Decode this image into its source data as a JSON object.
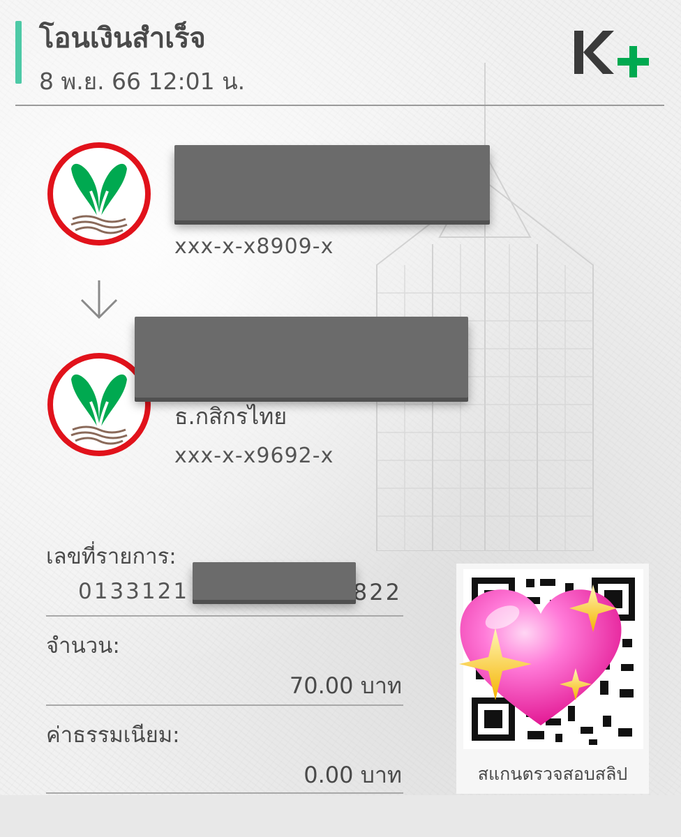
{
  "header": {
    "title": "โอนเงินสำเร็จ",
    "datetime": "8 พ.ย. 66  12:01 น.",
    "brand_logo_text": "K+"
  },
  "sender": {
    "bank_icon": "kasikorn-bank-logo",
    "account": "xxx-x-x8909-x"
  },
  "receiver": {
    "bank_icon": "kasikorn-bank-logo",
    "bank_name": "ธ.กสิกรไทย",
    "account": "xxx-x-x9692-x"
  },
  "details": {
    "reference_label": "เลขที่รายการ:",
    "reference_prefix": "0133121",
    "reference_suffix": "822",
    "amount_label": "จำนวน:",
    "amount_value": "70.00 บาท",
    "fee_label": "ค่าธรรมเนียม:",
    "fee_value": "0.00 บาท"
  },
  "qr": {
    "caption": "สแกนตรวจสอบสลิป",
    "overlay_icon": "sparkling-heart-emoji"
  },
  "colors": {
    "accent": "#4dc9a6",
    "brand_green": "#00a950",
    "kbank_red": "#e1121b",
    "redaction": "#6b6b6b"
  }
}
